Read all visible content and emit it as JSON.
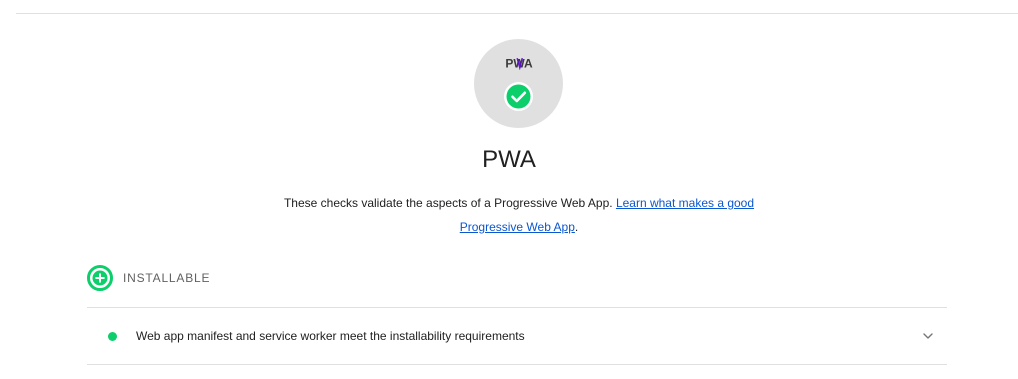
{
  "category": {
    "logo_text": "PWA",
    "title": "PWA",
    "description_text": "These checks validate the aspects of a Progressive Web App. ",
    "learn_more_link": "Learn what makes a good Progressive Web App",
    "description_end": "."
  },
  "group": {
    "title": "INSTALLABLE",
    "icon": "plus-circle-icon"
  },
  "audits": [
    {
      "title": "Web app manifest and service worker meet the installability requirements",
      "status": "pass"
    }
  ],
  "colors": {
    "pass": "#0cce6b",
    "badge_bg": "#e0e0e0",
    "link": "#0b57d0",
    "text": "#212121",
    "muted": "#616161"
  }
}
